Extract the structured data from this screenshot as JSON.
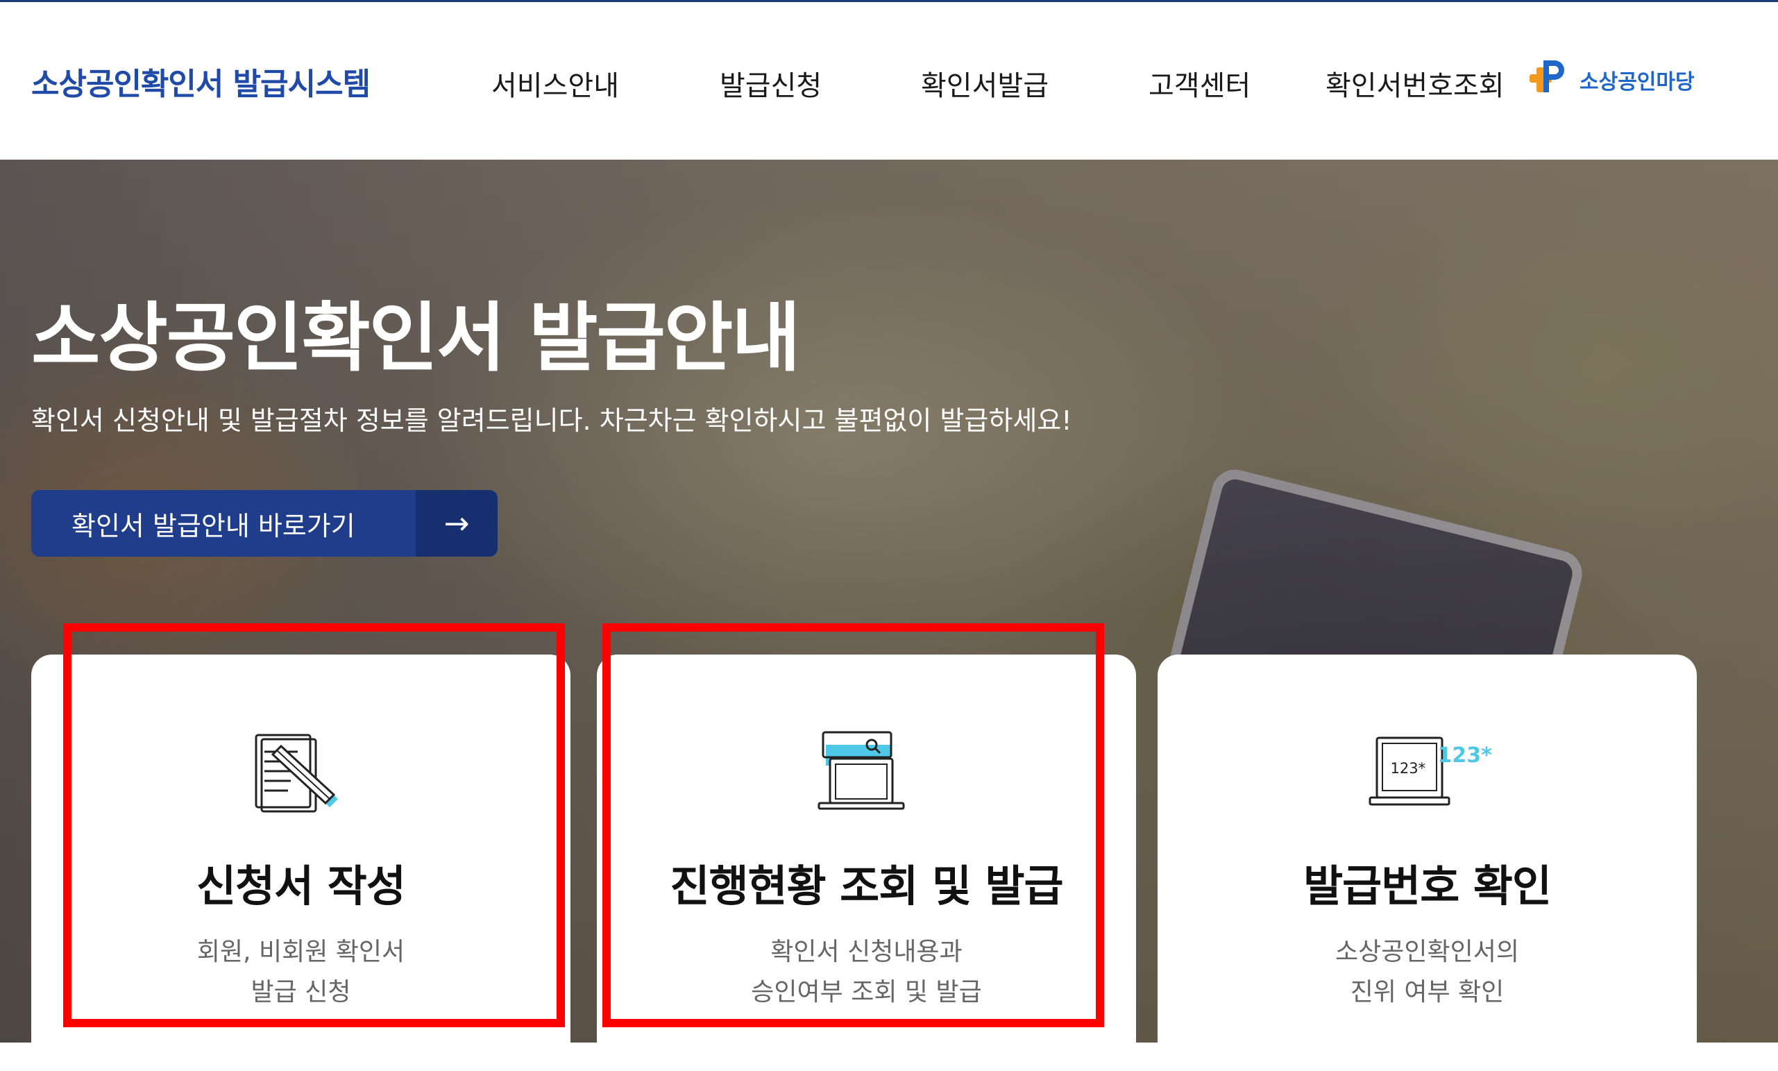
{
  "header": {
    "logo": "소상공인확인서 발급시스템",
    "nav": [
      "서비스안내",
      "발급신청",
      "확인서발급",
      "고객센터",
      "확인서번호조회"
    ],
    "brand": "소상공인마당"
  },
  "hero": {
    "title": "소상공인확인서 발급안내",
    "subtitle": "확인서 신청안내 및 발급절차 정보를 알려드립니다. 차근차근 확인하시고 불편없이 발급하세요!",
    "button_label": "확인서 발급안내 바로가기",
    "button_arrow": "→"
  },
  "cards": [
    {
      "icon": "document-pen-icon",
      "title": "신청서 작성",
      "desc": [
        "회원, 비회원 확인서",
        "발급 신청"
      ]
    },
    {
      "icon": "laptop-search-icon",
      "title": "진행현황 조회 및 발급",
      "desc": [
        "확인서 신청내용과",
        "승인여부 조회 및 발급"
      ]
    },
    {
      "icon": "laptop-number-icon",
      "title": "발급번호 확인",
      "desc": [
        "소상공인확인서의",
        "진위 여부 확인"
      ]
    }
  ],
  "icon_text": {
    "number_small": "123*",
    "number_large": "123*"
  },
  "colors": {
    "brand_blue": "#1f4aa8",
    "button_blue": "#1f3d8a",
    "highlight_red": "#ff0000",
    "icon_cyan": "#4fc8e8"
  }
}
